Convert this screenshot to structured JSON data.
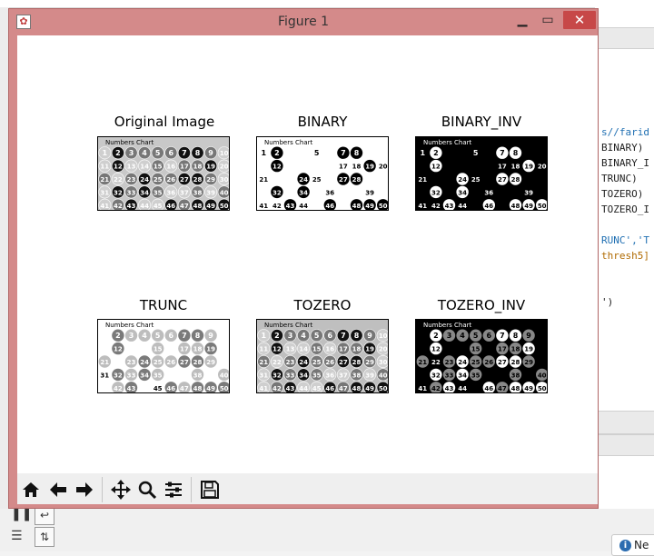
{
  "window": {
    "title": "Figure 1"
  },
  "colors": {
    "titlebar": "#d48a8a",
    "close": "#c74848"
  },
  "background_code": {
    "lines": [
      "s//farid",
      "BINARY)",
      "BINARY_I",
      "TRUNC)",
      "TOZERO)",
      "TOZERO_I",
      "",
      "RUNC','T",
      "thresh5]",
      "",
      "",
      "')"
    ]
  },
  "notification": {
    "label": "Ne"
  },
  "subplots": [
    {
      "title": "Original Image",
      "mode": "original"
    },
    {
      "title": "BINARY",
      "mode": "binary"
    },
    {
      "title": "BINARY_INV",
      "mode": "binary_inv"
    },
    {
      "title": "TRUNC",
      "mode": "trunc"
    },
    {
      "title": "TOZERO",
      "mode": "tozero"
    },
    {
      "title": "TOZERO_INV",
      "mode": "tozero_inv"
    }
  ],
  "image": {
    "header_text": "Numbers Chart",
    "rows": [
      [
        "1",
        "2",
        "3",
        "4",
        "5",
        "6",
        "7",
        "8",
        "9",
        "10"
      ],
      [
        "11",
        "12",
        "13",
        "14",
        "15",
        "16",
        "17",
        "18",
        "19",
        "20"
      ],
      [
        "21",
        "22",
        "23",
        "24",
        "25",
        "26",
        "27",
        "28",
        "29",
        "30"
      ],
      [
        "31",
        "32",
        "33",
        "34",
        "35",
        "36",
        "37",
        "38",
        "39",
        "40"
      ],
      [
        "41",
        "42",
        "43",
        "44",
        "45",
        "46",
        "47",
        "48",
        "49",
        "50"
      ]
    ]
  },
  "toolbar": {
    "buttons": [
      {
        "name": "home-button",
        "icon": "home-icon"
      },
      {
        "name": "back-button",
        "icon": "arrow-left-icon"
      },
      {
        "name": "forward-button",
        "icon": "arrow-right-icon"
      },
      {
        "name": "pan-button",
        "icon": "move-icon"
      },
      {
        "name": "zoom-button",
        "icon": "magnifier-icon"
      },
      {
        "name": "configure-subplots-button",
        "icon": "sliders-icon"
      },
      {
        "name": "save-button",
        "icon": "floppy-icon"
      }
    ]
  }
}
